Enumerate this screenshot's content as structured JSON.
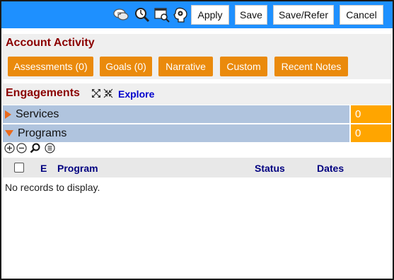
{
  "toolbar": {
    "icons": [
      "chat-bubbles-icon",
      "search-history-icon",
      "window-search-icon",
      "gear-settings-icon"
    ],
    "buttons": {
      "apply": "Apply",
      "save": "Save",
      "save_refer": "Save/Refer",
      "cancel": "Cancel"
    }
  },
  "account_activity": {
    "title": "Account Activity",
    "buttons": [
      "Assessments (0)",
      "Goals (0)",
      "Narrative",
      "Custom",
      "Recent Notes"
    ]
  },
  "engagements": {
    "title": "Engagements",
    "explore_label": "Explore",
    "categories": [
      {
        "label": "Services",
        "count": "0",
        "expanded": false
      },
      {
        "label": "Programs",
        "count": "0",
        "expanded": true
      }
    ],
    "grid": {
      "columns": [
        "E",
        "Program",
        "Status",
        "Dates"
      ],
      "empty_message": "No records to display."
    }
  },
  "colors": {
    "toolbar_bg": "#1e90ff",
    "section_title": "#8b0000",
    "orange_button": "#ea8a0c",
    "category_row": "#b0c4de",
    "count_cell": "#ffa500",
    "grid_header_text": "#000080"
  }
}
